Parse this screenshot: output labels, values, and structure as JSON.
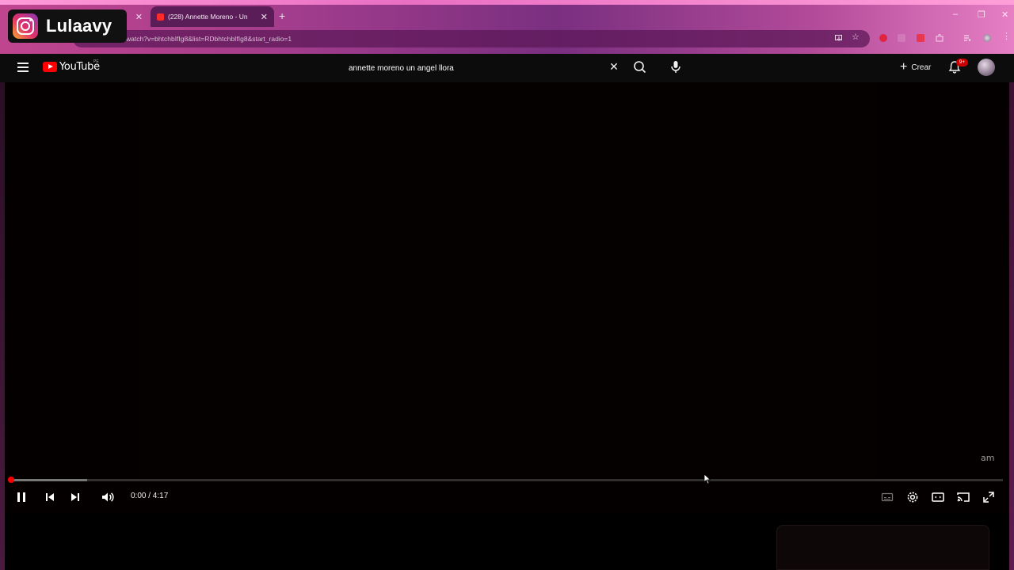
{
  "overlay": {
    "brand_icon": "instagram-logo",
    "username": "Lulaavy"
  },
  "browser": {
    "tabs": [
      {
        "title": "",
        "state": "inactive"
      },
      {
        "title": "(228) Annette Moreno - Un",
        "state": "active",
        "favicon": "youtube-favicon"
      }
    ],
    "new_tab_label": "+",
    "url": "youtube.com/watch?v=bhtchbIfIg8&list=RDbhtchbIfIg8&start_radio=1",
    "window_controls": {
      "minimize": "–",
      "restore": "❐",
      "close": "✕"
    }
  },
  "youtube": {
    "logo_text": "YouTube",
    "region_code": "PE",
    "search": {
      "query": "annette moreno un angel llora",
      "clear_symbol": "✕"
    },
    "create_label": "Crear",
    "notifications_count": "9+"
  },
  "player": {
    "state": "playing",
    "current_time": "0:00",
    "duration": "4:17",
    "time_display": "0:00 / 4:17",
    "progress_fraction": 0.0,
    "buffered_fraction": 0.077,
    "watermark": "am",
    "controls": [
      "pause-icon",
      "previous-icon",
      "next-icon",
      "volume-icon",
      "subtitles-icon",
      "settings-icon",
      "theater-icon",
      "cast-icon",
      "fullscreen-icon"
    ]
  },
  "colors": {
    "youtube_red": "#ff0000",
    "chrome_pink": "#c0458f",
    "masthead_bg": "#0c0c0c"
  }
}
